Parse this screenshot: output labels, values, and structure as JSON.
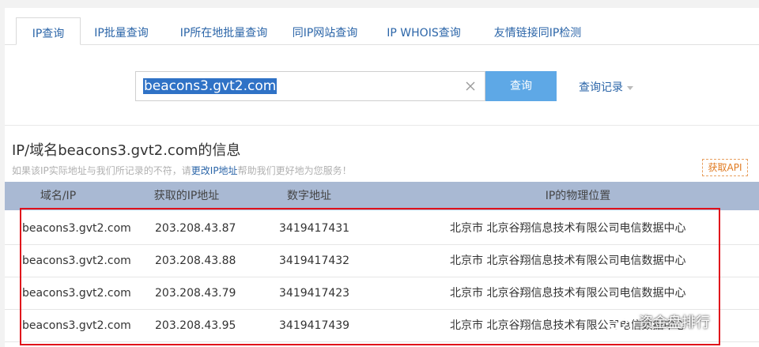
{
  "tabs": [
    {
      "label": "IP查询",
      "active": true
    },
    {
      "label": "IP批量查询",
      "active": false
    },
    {
      "label": "IP所在地批量查询",
      "active": false
    },
    {
      "label": "同IP网站查询",
      "active": false
    },
    {
      "label": "IP WHOIS查询",
      "active": false
    },
    {
      "label": "友情链接同IP检测",
      "active": false
    }
  ],
  "search": {
    "value": "beacons3.gvt2.com",
    "button_label": "查询",
    "history_label": "查询记录"
  },
  "info": {
    "title": "IP/域名beacons3.gvt2.com的信息",
    "note_before": "如果该IP实际地址与我们所记录的不符，请",
    "note_link": "更改IP地址",
    "note_after": "帮助我们更好地为您服务！",
    "api_button": "获取API"
  },
  "table": {
    "headers": [
      "域名/IP",
      "获取的IP地址",
      "数字地址",
      "IP的物理位置"
    ],
    "rows": [
      {
        "domain": "beacons3.gvt2.com",
        "ip": "203.208.43.87",
        "number": "3419417431",
        "location": "北京市 北京谷翔信息技术有限公司电信数据中心"
      },
      {
        "domain": "beacons3.gvt2.com",
        "ip": "203.208.43.88",
        "number": "3419417432",
        "location": "北京市 北京谷翔信息技术有限公司电信数据中心"
      },
      {
        "domain": "beacons3.gvt2.com",
        "ip": "203.208.43.79",
        "number": "3419417423",
        "location": "北京市 北京谷翔信息技术有限公司电信数据中心"
      },
      {
        "domain": "beacons3.gvt2.com",
        "ip": "203.208.43.95",
        "number": "3419417439",
        "location": "北京市 北京谷翔信息技术有限公司电信数据中心"
      }
    ]
  },
  "watermark": {
    "text": "资金盘排行"
  },
  "colors": {
    "accent": "#5ea8e6",
    "link": "#2b65a8",
    "table_header": "#a9b9d3",
    "highlight_border": "#e0111b"
  }
}
